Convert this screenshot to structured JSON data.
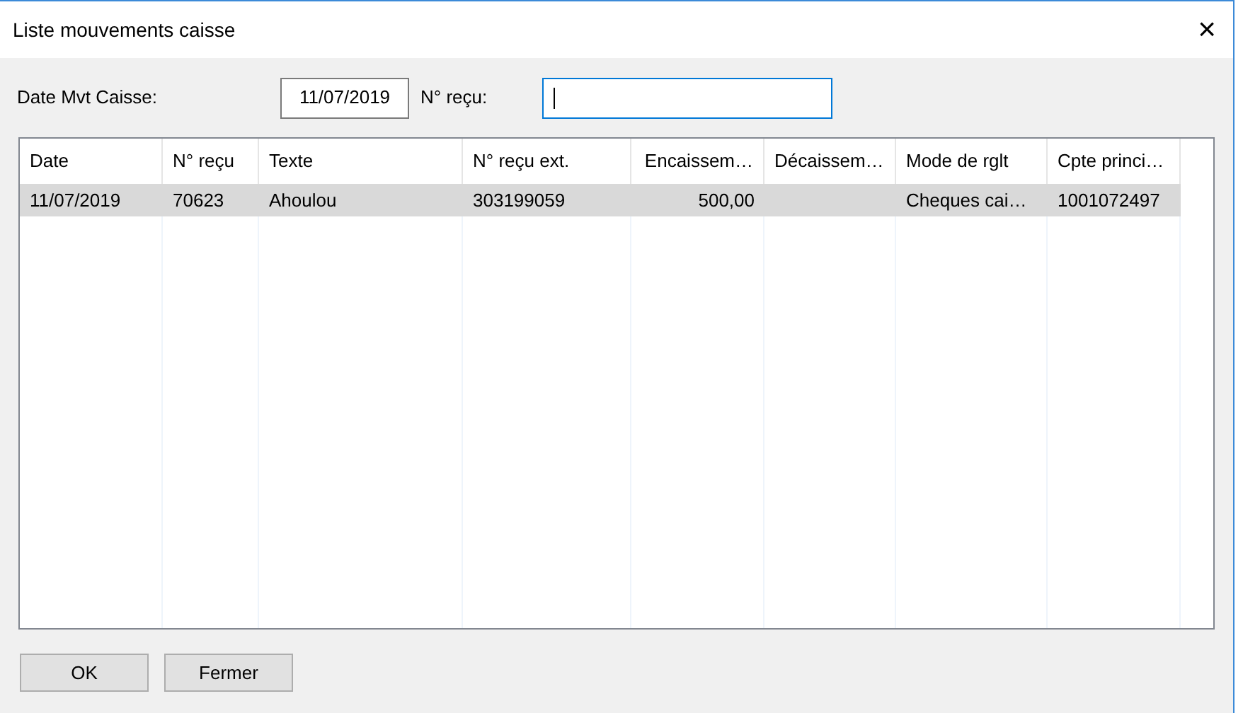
{
  "window": {
    "title": "Liste mouvements caisse",
    "close": "×"
  },
  "filters": {
    "date_label": "Date Mvt Caisse:",
    "date_value": "11/07/2019",
    "receipt_label": "N° reçu:",
    "receipt_focused": true
  },
  "table": {
    "columns": [
      "Date",
      "N° reçu",
      "Texte",
      "N° reçu ext.",
      "Encaissem…",
      "Décaissem…",
      "Mode de rglt",
      "Cpte princi…"
    ],
    "rows": [
      {
        "selected": true,
        "cells": [
          "11/07/2019",
          "70623",
          "Ahoulou",
          "303199059",
          "500,00",
          "",
          "Cheques cai…",
          "1001072497"
        ]
      }
    ]
  },
  "buttons": [
    "OK",
    "Fermer"
  ]
}
